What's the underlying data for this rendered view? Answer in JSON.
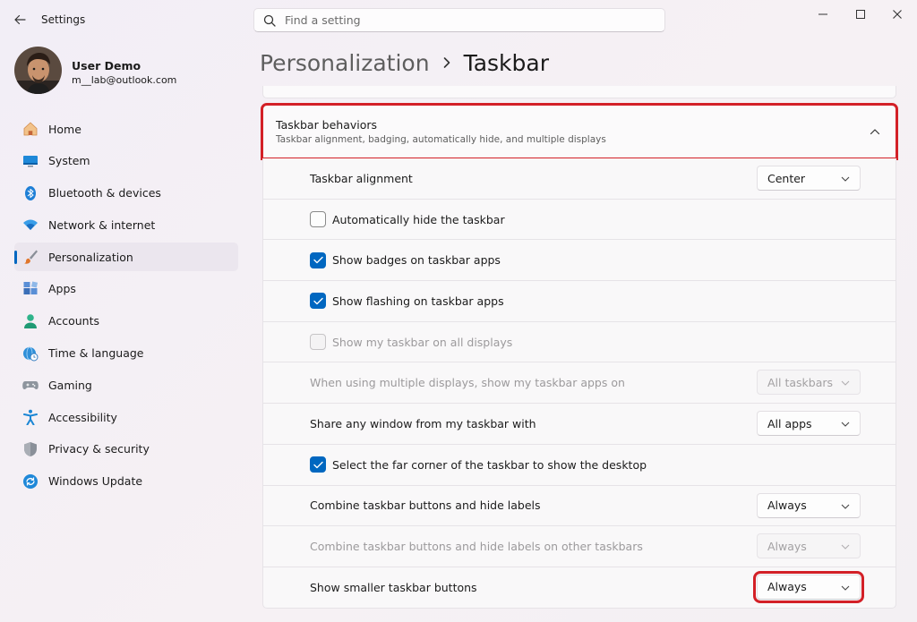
{
  "window": {
    "title": "Settings",
    "search_placeholder": "Find a setting"
  },
  "user": {
    "name": "User Demo",
    "email": "m__lab@outlook.com"
  },
  "nav": {
    "items": [
      {
        "label": "Home",
        "icon": "home-icon"
      },
      {
        "label": "System",
        "icon": "system-icon"
      },
      {
        "label": "Bluetooth & devices",
        "icon": "bluetooth-icon"
      },
      {
        "label": "Network & internet",
        "icon": "wifi-icon"
      },
      {
        "label": "Personalization",
        "icon": "brush-icon",
        "active": true
      },
      {
        "label": "Apps",
        "icon": "apps-icon"
      },
      {
        "label": "Accounts",
        "icon": "person-icon"
      },
      {
        "label": "Time & language",
        "icon": "globe-clock-icon"
      },
      {
        "label": "Gaming",
        "icon": "gamepad-icon"
      },
      {
        "label": "Accessibility",
        "icon": "accessibility-icon"
      },
      {
        "label": "Privacy & security",
        "icon": "shield-icon"
      },
      {
        "label": "Windows Update",
        "icon": "update-icon"
      }
    ]
  },
  "breadcrumb": {
    "parent": "Personalization",
    "current": "Taskbar"
  },
  "section": {
    "title": "Taskbar behaviors",
    "subtitle": "Taskbar alignment, badging, automatically hide, and multiple displays"
  },
  "settings": {
    "alignment": {
      "label": "Taskbar alignment",
      "value": "Center"
    },
    "autohide": {
      "label": "Automatically hide the taskbar",
      "checked": false
    },
    "badges": {
      "label": "Show badges on taskbar apps",
      "checked": true
    },
    "flashing": {
      "label": "Show flashing on taskbar apps",
      "checked": true
    },
    "all_displays": {
      "label": "Show my taskbar on all displays",
      "checked": false,
      "disabled": true
    },
    "multi_display_apps": {
      "label": "When using multiple displays, show my taskbar apps on",
      "value": "All taskbars",
      "disabled": true
    },
    "share_window": {
      "label": "Share any window from my taskbar with",
      "value": "All apps"
    },
    "far_corner": {
      "label": "Select the far corner of the taskbar to show the desktop",
      "checked": true
    },
    "combine": {
      "label": "Combine taskbar buttons and hide labels",
      "value": "Always"
    },
    "combine_other": {
      "label": "Combine taskbar buttons and hide labels on other taskbars",
      "value": "Always",
      "disabled": true
    },
    "smaller_buttons": {
      "label": "Show smaller taskbar buttons",
      "value": "Always"
    }
  },
  "colors": {
    "accent": "#0067c0",
    "highlight": "#d32027"
  }
}
